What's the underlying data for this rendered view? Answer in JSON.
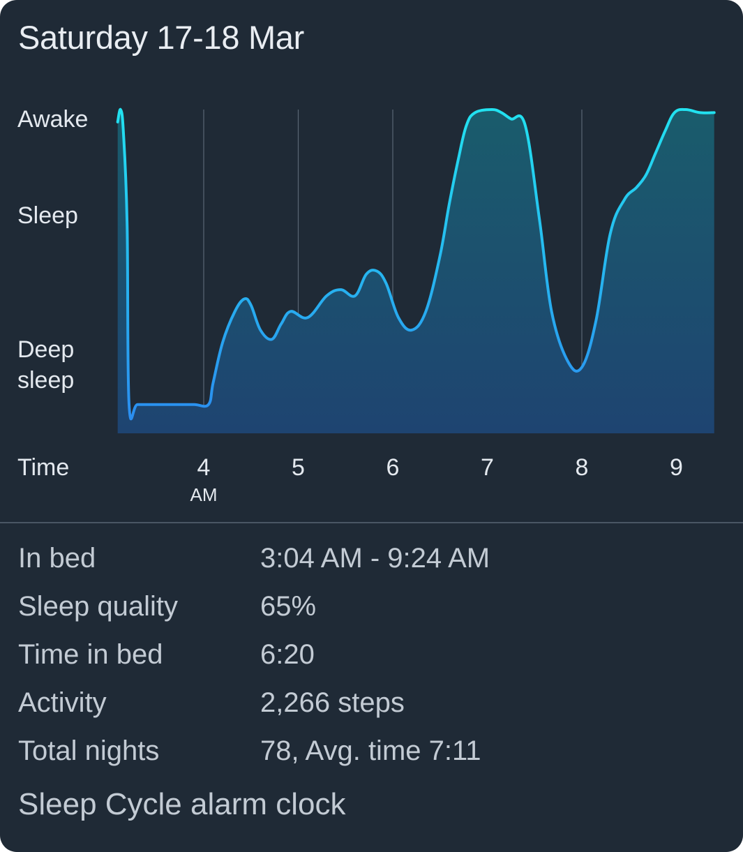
{
  "header": {
    "title": "Saturday 17-18 Mar"
  },
  "colors": {
    "background": "#1f2a36",
    "line_top": "#22e3f0",
    "line_bottom": "#2b8df0",
    "fill_top": "#1a5c6c",
    "fill_bottom": "#1e4471",
    "grid": "#5a6674"
  },
  "chart_data": {
    "type": "area",
    "title": "",
    "xlabel": "Time",
    "ylabel": "",
    "y_levels": [
      "Awake",
      "Sleep",
      "Deep sleep"
    ],
    "y_level_lines": [
      [
        "Awake"
      ],
      [
        "Sleep"
      ],
      [
        "Deep",
        "sleep"
      ]
    ],
    "x_ticks": [
      {
        "value": 4,
        "label": "4",
        "sub": "AM"
      },
      {
        "value": 5,
        "label": "5",
        "sub": ""
      },
      {
        "value": 6,
        "label": "6",
        "sub": ""
      },
      {
        "value": 7,
        "label": "7",
        "sub": ""
      },
      {
        "value": 8,
        "label": "8",
        "sub": ""
      },
      {
        "value": 9,
        "label": "9",
        "sub": ""
      }
    ],
    "xlim": [
      3.09,
      9.4
    ],
    "ylim": [
      0,
      1
    ],
    "grid": true,
    "series": [
      {
        "values": [
          [
            3.09,
            0.96
          ],
          [
            3.12,
            1.0
          ],
          [
            3.15,
            0.93
          ],
          [
            3.19,
            0.63
          ],
          [
            3.21,
            0.05
          ],
          [
            3.3,
            0.05
          ],
          [
            3.5,
            0.05
          ],
          [
            3.7,
            0.05
          ],
          [
            3.9,
            0.05
          ],
          [
            4.05,
            0.05
          ],
          [
            4.1,
            0.12
          ],
          [
            4.2,
            0.25
          ],
          [
            4.33,
            0.35
          ],
          [
            4.43,
            0.39
          ],
          [
            4.5,
            0.37
          ],
          [
            4.6,
            0.29
          ],
          [
            4.72,
            0.26
          ],
          [
            4.82,
            0.31
          ],
          [
            4.92,
            0.35
          ],
          [
            5.1,
            0.33
          ],
          [
            5.3,
            0.4
          ],
          [
            5.45,
            0.42
          ],
          [
            5.6,
            0.4
          ],
          [
            5.72,
            0.47
          ],
          [
            5.83,
            0.48
          ],
          [
            5.93,
            0.44
          ],
          [
            6.06,
            0.33
          ],
          [
            6.2,
            0.29
          ],
          [
            6.35,
            0.35
          ],
          [
            6.5,
            0.53
          ],
          [
            6.6,
            0.7
          ],
          [
            6.7,
            0.85
          ],
          [
            6.78,
            0.95
          ],
          [
            6.87,
            0.99
          ],
          [
            7.05,
            1.0
          ],
          [
            7.15,
            0.99
          ],
          [
            7.25,
            0.97
          ],
          [
            7.4,
            0.95
          ],
          [
            7.55,
            0.65
          ],
          [
            7.68,
            0.35
          ],
          [
            7.85,
            0.19
          ],
          [
            8.0,
            0.17
          ],
          [
            8.15,
            0.32
          ],
          [
            8.3,
            0.6
          ],
          [
            8.45,
            0.71
          ],
          [
            8.58,
            0.75
          ],
          [
            8.68,
            0.79
          ],
          [
            8.78,
            0.86
          ],
          [
            8.88,
            0.93
          ],
          [
            8.98,
            0.99
          ],
          [
            9.1,
            1.0
          ],
          [
            9.25,
            0.99
          ],
          [
            9.4,
            0.99
          ]
        ]
      }
    ]
  },
  "stats": [
    {
      "label": "In bed",
      "value": "3:04 AM - 9:24 AM"
    },
    {
      "label": "Sleep quality",
      "value": "65%"
    },
    {
      "label": "Time in bed",
      "value": "6:20"
    },
    {
      "label": "Activity",
      "value": "2,266 steps"
    },
    {
      "label": "Total nights",
      "value": "78, Avg. time 7:11"
    }
  ],
  "footer": {
    "label": "Sleep Cycle alarm clock"
  }
}
